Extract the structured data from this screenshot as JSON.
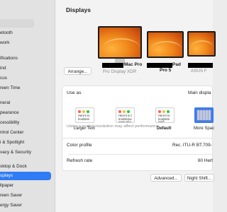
{
  "sidebar": {
    "items": [
      {
        "label": "etooth"
      },
      {
        "label": "work"
      },
      {
        "label": "ifications"
      },
      {
        "label": "ind"
      },
      {
        "label": "cus"
      },
      {
        "label": "reen Time"
      },
      {
        "label": "neral"
      },
      {
        "label": "pearance"
      },
      {
        "label": "cessibility"
      },
      {
        "label": "ntrol Center"
      },
      {
        "label": "i & Spotlight"
      },
      {
        "label": "vacy & Security"
      },
      {
        "label": "sktop & Dock"
      },
      {
        "label": "splays"
      },
      {
        "label": "llpaper"
      },
      {
        "label": "reen Saver"
      },
      {
        "label": "ergy Saver"
      }
    ]
  },
  "main": {
    "title": "Displays",
    "arrange_label": "Arrange...",
    "monitors": [
      {
        "name": "Mac Pro",
        "subtitle": "Pro Display XDR"
      },
      {
        "name": "Pad",
        "subtitle": "Pro 5"
      },
      {
        "name": "",
        "subtitle": "ASUS F"
      }
    ],
    "use_as": {
      "label": "Use as",
      "value": "Main displa"
    },
    "resolutions": [
      {
        "caption": "Larger Text",
        "sample": "Here's to\ntroublem"
      },
      {
        "caption": "",
        "sample": "Here's to t\ntroublema\nones who"
      },
      {
        "caption": "Default",
        "sample": "Here's to\ntroublem\nmisfi"
      },
      {
        "caption": "More Spac",
        "sample": ""
      }
    ],
    "scaled_note": "Using a scaled resolution may affect performance.",
    "color_profile": {
      "label": "Color profile",
      "value": "Rec. ITU-R BT.709-"
    },
    "refresh_rate": {
      "label": "Refresh rate",
      "value": "60 Hert"
    },
    "advanced_label": "Advanced...",
    "night_shift_label": "Night Shift..."
  }
}
